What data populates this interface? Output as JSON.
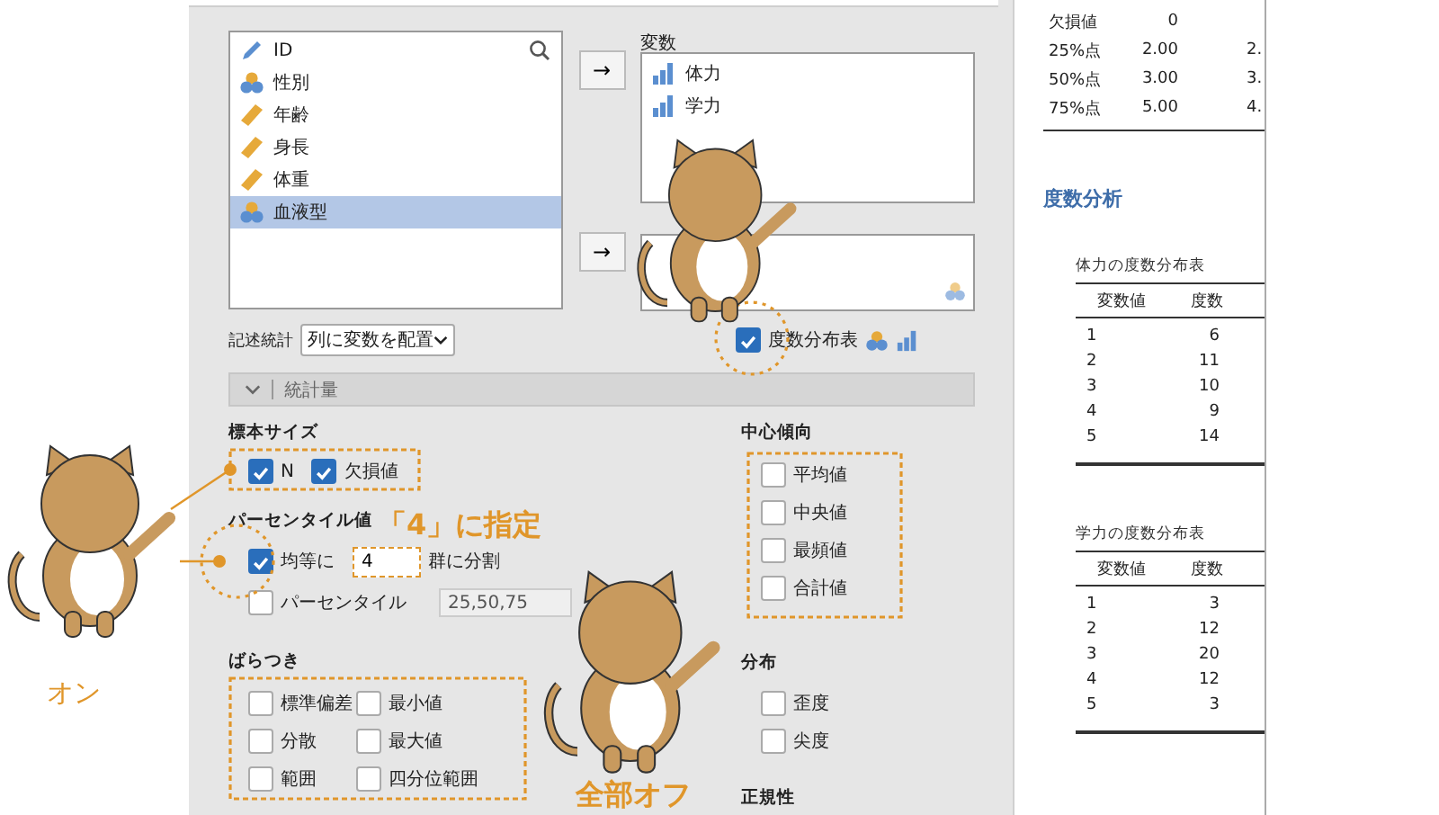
{
  "variable_list": {
    "items": [
      {
        "name": "ID",
        "kind": "id",
        "selected": false
      },
      {
        "name": "性別",
        "kind": "nominal",
        "selected": false
      },
      {
        "name": "年齢",
        "kind": "continuous",
        "selected": false
      },
      {
        "name": "身長",
        "kind": "continuous",
        "selected": false
      },
      {
        "name": "体重",
        "kind": "continuous",
        "selected": false
      },
      {
        "name": "血液型",
        "kind": "nominal",
        "selected": true
      }
    ]
  },
  "move_buttons": [
    "→",
    "→"
  ],
  "variables_box": {
    "label": "変数",
    "items": [
      {
        "name": "体力",
        "kind": "ordinal"
      },
      {
        "name": "学力",
        "kind": "ordinal"
      }
    ]
  },
  "layout": {
    "label": "記述統計",
    "value": "列に変数を配置"
  },
  "freq_table": {
    "label": "度数分布表",
    "checked": true
  },
  "section": {
    "label": "統計量",
    "expanded": true
  },
  "sample_size": {
    "title": "標本サイズ",
    "options": [
      {
        "label": "N",
        "checked": true
      },
      {
        "label": "欠損値",
        "checked": true
      }
    ]
  },
  "percentiles": {
    "title": "パーセンタイル値",
    "equal": {
      "label": "均等に",
      "checked": true,
      "value": "4",
      "suffix": "群に分割"
    },
    "custom": {
      "label": "パーセンタイル",
      "checked": false,
      "value": "25,50,75"
    }
  },
  "dispersion": {
    "title": "ばらつき",
    "options": [
      {
        "label": "標準偏差",
        "checked": false
      },
      {
        "label": "最小値",
        "checked": false
      },
      {
        "label": "分散",
        "checked": false
      },
      {
        "label": "最大値",
        "checked": false
      },
      {
        "label": "範囲",
        "checked": false
      },
      {
        "label": "四分位範囲",
        "checked": false
      }
    ]
  },
  "central_tendency": {
    "title": "中心傾向",
    "options": [
      {
        "label": "平均値",
        "checked": false
      },
      {
        "label": "中央値",
        "checked": false
      },
      {
        "label": "最頻値",
        "checked": false
      },
      {
        "label": "合計値",
        "checked": false
      }
    ]
  },
  "distribution": {
    "title": "分布",
    "options": [
      {
        "label": "歪度",
        "checked": false
      },
      {
        "label": "尖度",
        "checked": false
      }
    ]
  },
  "normality": {
    "title": "正規性"
  },
  "results": {
    "summary_rows": [
      [
        "欠損値",
        "0",
        ""
      ],
      [
        "25%点",
        "2.00",
        "2."
      ],
      [
        "50%点",
        "3.00",
        "3."
      ],
      [
        "75%点",
        "5.00",
        "4."
      ]
    ],
    "heading": "度数分析",
    "tables": [
      {
        "title": "体力の度数分布表",
        "columns": [
          "変数値",
          "度数"
        ],
        "rows": [
          [
            "1",
            "6"
          ],
          [
            "2",
            "11"
          ],
          [
            "3",
            "10"
          ],
          [
            "4",
            "9"
          ],
          [
            "5",
            "14"
          ]
        ]
      },
      {
        "title": "学力の度数分布表",
        "columns": [
          "変数値",
          "度数"
        ],
        "rows": [
          [
            "1",
            "3"
          ],
          [
            "2",
            "12"
          ],
          [
            "3",
            "20"
          ],
          [
            "4",
            "12"
          ],
          [
            "5",
            "3"
          ]
        ]
      }
    ]
  },
  "annotations": [
    "「4」に指定",
    "オン",
    "全部オフ"
  ]
}
